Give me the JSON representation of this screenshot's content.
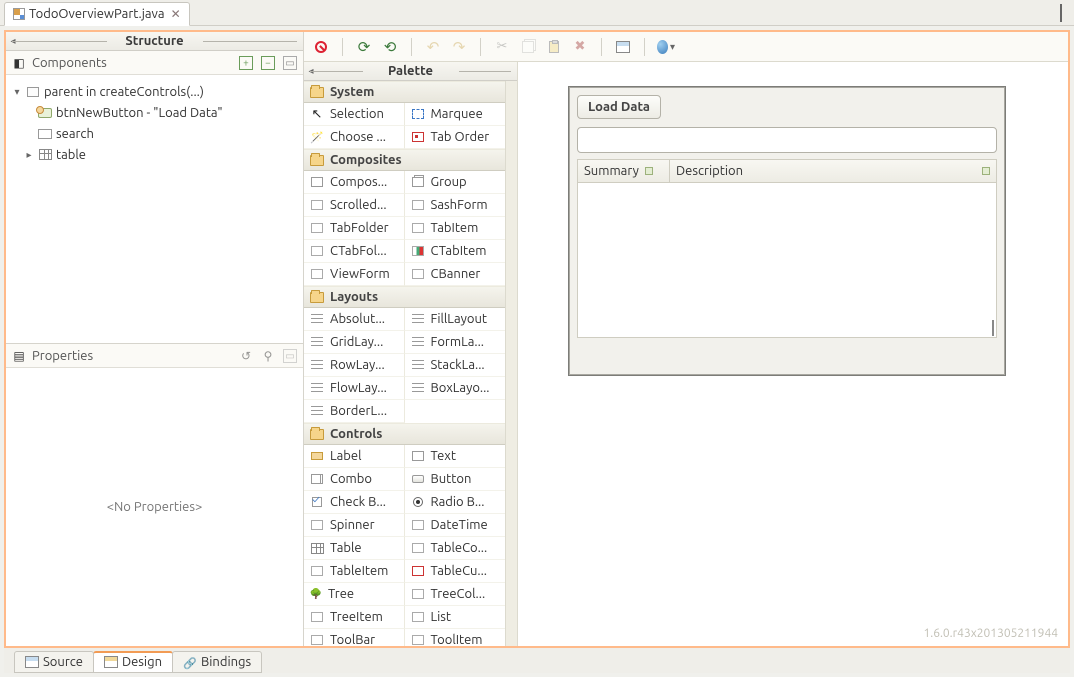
{
  "file_tab": {
    "label": "TodoOverviewPart.java"
  },
  "structure": {
    "title": "Structure",
    "components_label": "Components",
    "nodes": {
      "root": "parent in createControls(...)",
      "btn": "btnNewButton - \"Load Data\"",
      "search": "search",
      "table": "table"
    }
  },
  "properties": {
    "label": "Properties",
    "empty": "<No Properties>"
  },
  "palette": {
    "title": "Palette",
    "categories": {
      "system": "System",
      "composites": "Composites",
      "layouts": "Layouts",
      "controls": "Controls"
    },
    "items": {
      "selection": "Selection",
      "marquee": "Marquee",
      "choose": "Choose ...",
      "taborder": "Tab Order",
      "composite": "Compos...",
      "group": "Group",
      "scrolled": "Scrolled...",
      "sashform": "SashForm",
      "tabfolder": "TabFolder",
      "tabitem": "TabItem",
      "ctabfolder": "CTabFol...",
      "ctabitem": "CTabItem",
      "viewform": "ViewForm",
      "cbanner": "CBanner",
      "absolute": "Absolut...",
      "filllayout": "FillLayout",
      "gridlayout": "GridLay...",
      "formlayout": "FormLa...",
      "rowlayout": "RowLay...",
      "stacklayout": "StackLa...",
      "flowlayout": "FlowLay...",
      "boxlayout": "BoxLayo...",
      "borderlayout": "BorderL...",
      "label": "Label",
      "text": "Text",
      "combo": "Combo",
      "button": "Button",
      "checkbox": "Check B...",
      "radio": "Radio B...",
      "spinner": "Spinner",
      "datetime": "DateTime",
      "ptable": "Table",
      "tablecol": "TableCo...",
      "tableitem": "TableItem",
      "tablecursor": "TableCu...",
      "tree": "Tree",
      "treecol": "TreeCol...",
      "treeitem": "TreeItem",
      "list": "List",
      "toolbar": "ToolBar",
      "toolitem": "ToolItem"
    }
  },
  "canvas": {
    "load_button": "Load Data",
    "col_summary": "Summary",
    "col_description": "Description"
  },
  "version": "1.6.0.r43x201305211944",
  "bottom_tabs": {
    "source": "Source",
    "design": "Design",
    "bindings": "Bindings"
  }
}
